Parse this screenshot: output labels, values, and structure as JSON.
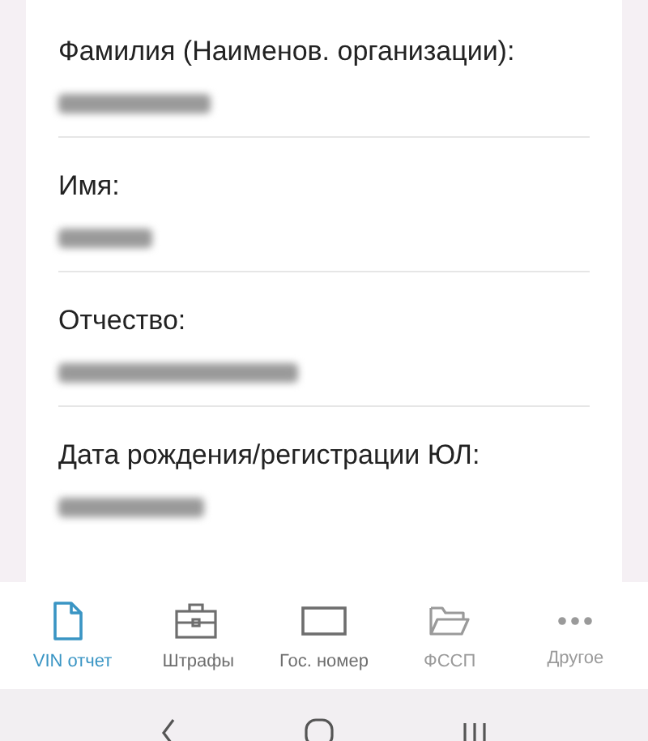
{
  "fields": [
    {
      "label": "Фамилия (Наименов. организации):",
      "redacted": true
    },
    {
      "label": "Имя:",
      "redacted": true
    },
    {
      "label": "Отчество:",
      "redacted": true
    },
    {
      "label": "Дата рождения/регистрации ЮЛ:",
      "redacted": true
    }
  ],
  "bottom_nav": [
    {
      "kind": "document",
      "label": "VIN отчет",
      "selected": true,
      "disabled": false
    },
    {
      "kind": "briefcase",
      "label": "Штрафы",
      "selected": false,
      "disabled": false
    },
    {
      "kind": "plate",
      "label": "Гос. номер",
      "selected": false,
      "disabled": false
    },
    {
      "kind": "folder",
      "label": "ФССП",
      "selected": false,
      "disabled": true
    },
    {
      "kind": "more",
      "label": "Другое",
      "selected": false,
      "disabled": true
    }
  ]
}
